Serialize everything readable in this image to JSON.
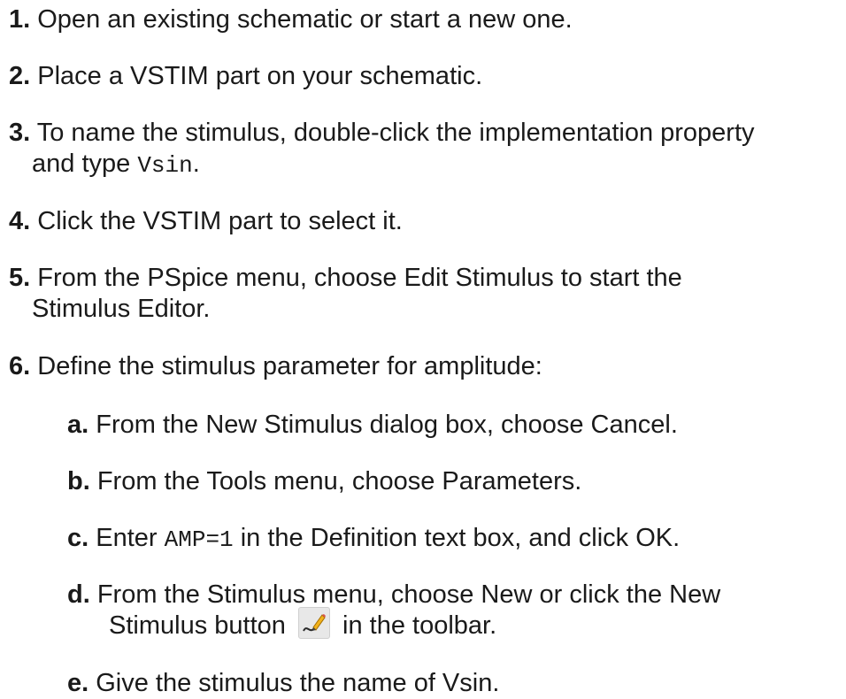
{
  "steps": [
    {
      "num": "1.",
      "text": "Open an existing schematic or start a new one."
    },
    {
      "num": "2.",
      "text": "Place a VSTIM part on your schematic."
    },
    {
      "num": "3.",
      "line1": "To name the stimulus, double-click the implementation property",
      "line2_pre": "and type",
      "code": "Vsin",
      "line2_post": "."
    },
    {
      "num": "4.",
      "text": "Click the VSTIM part to select it."
    },
    {
      "num": "5.",
      "line1": "From the PSpice menu, choose Edit Stimulus to start the",
      "line2": "Stimulus Editor."
    },
    {
      "num": "6.",
      "text": "Define the stimulus parameter for amplitude:"
    }
  ],
  "substeps": [
    {
      "letter": "a.",
      "text": "From the New Stimulus dialog box, choose Cancel."
    },
    {
      "letter": "b.",
      "text": "From the Tools menu, choose Parameters."
    },
    {
      "letter": "c.",
      "pre": "Enter",
      "code": "AMP=1",
      "post": "in the Definition text box, and click OK."
    },
    {
      "letter": "d.",
      "line1": "From the Stimulus menu, choose New or click the New",
      "line2_pre": "Stimulus button",
      "icon": "new-stimulus-pencil-icon",
      "line2_post": "in the toolbar."
    },
    {
      "letter": "e.",
      "text": "Give the stimulus the name of Vsin."
    }
  ]
}
